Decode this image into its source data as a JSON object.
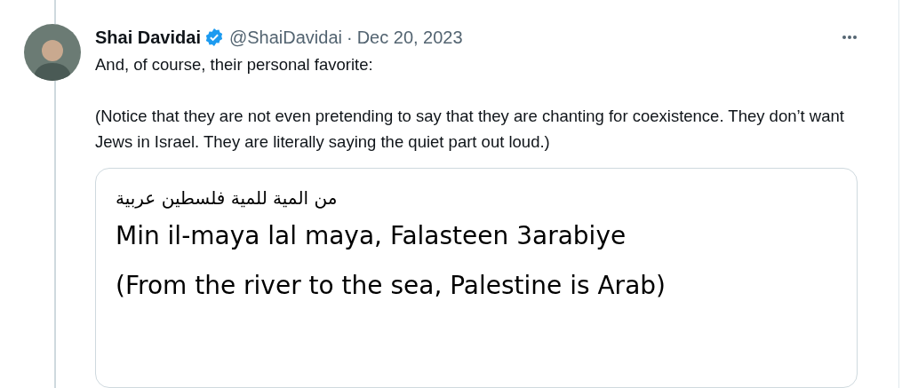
{
  "tweet": {
    "author": {
      "name": "Shai Davidai",
      "verified": true,
      "handle": "@ShaiDavidai",
      "separator": "·",
      "date": "Dec 20, 2023"
    },
    "paragraphs": [
      "And, of course, their personal favorite:",
      "(Notice that they are not even pretending to say that they are chanting for coexistence. They don’t want Jews in Israel. They are literally saying the quiet part out loud.)"
    ],
    "media_card": {
      "arabic": "من المية للمية فلسطين عربية",
      "lines": [
        "Min il-maya lal maya, Falasteen 3arabiye",
        "(From the river to the sea, Palestine is Arab)"
      ]
    }
  }
}
